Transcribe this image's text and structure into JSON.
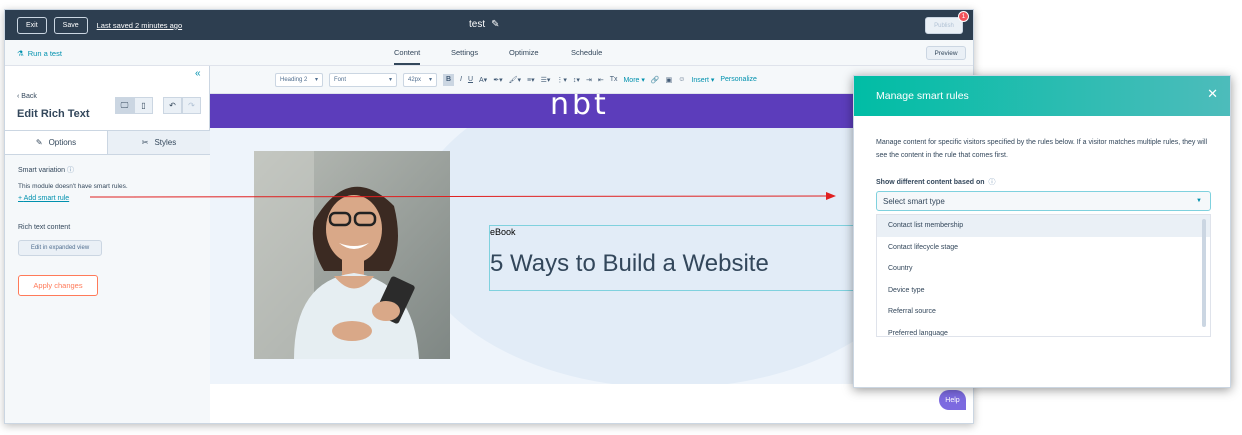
{
  "topbar": {
    "exit_label": "Exit",
    "save_label": "Save",
    "saved_text": "Last saved 2 minutes ago",
    "title": "test",
    "publish_label": "Publish",
    "notification_count": "1"
  },
  "tabsbar": {
    "run_test_label": "Run a test",
    "tabs": [
      {
        "label": "Content"
      },
      {
        "label": "Settings"
      },
      {
        "label": "Optimize"
      },
      {
        "label": "Schedule"
      }
    ],
    "preview_label": "Preview"
  },
  "sidebar": {
    "back_label": "Back",
    "title": "Edit Rich Text",
    "tabs": [
      {
        "label": "Options"
      },
      {
        "label": "Styles"
      }
    ],
    "smart_variation_label": "Smart variation",
    "no_rules_text": "This module doesn't have smart rules.",
    "add_rule_label": "Add smart rule",
    "rich_text_label": "Rich text content",
    "expanded_view_label": "Edit in expanded view",
    "apply_label": "Apply changes"
  },
  "toolbar": {
    "heading_value": "Heading 2",
    "font_value": "Font",
    "size_value": "42px",
    "more_label": "More",
    "insert_label": "Insert",
    "personalize_label": "Personalize"
  },
  "canvas": {
    "ebook_label": "eBook",
    "headline": "5 Ways to Build a Website",
    "help_label": "Help"
  },
  "modal": {
    "title": "Manage smart rules",
    "description": "Manage content for specific visitors specified by the rules below. If a visitor matches multiple rules, they will see the content in the rule that comes first.",
    "show_label": "Show different content based on",
    "select_placeholder": "Select smart type",
    "options": [
      {
        "label": "Contact list membership"
      },
      {
        "label": "Contact lifecycle stage"
      },
      {
        "label": "Country"
      },
      {
        "label": "Device type"
      },
      {
        "label": "Referral source"
      },
      {
        "label": "Preferred language"
      }
    ]
  },
  "colors": {
    "topbar": "#2d3e50",
    "accent": "#0091ae",
    "banner": "#5c3dbb",
    "modal_header": "#00bda5",
    "apply_orange": "#ff7a59",
    "annotation_arrow": "#e02020"
  }
}
